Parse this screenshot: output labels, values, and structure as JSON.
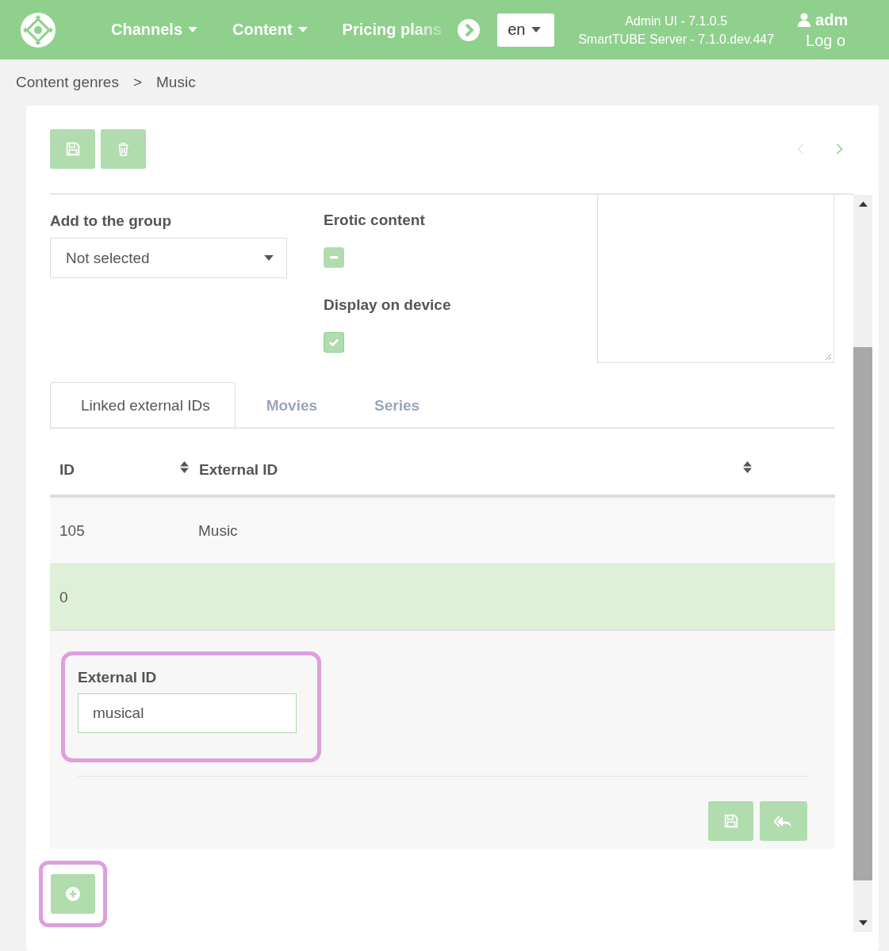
{
  "header": {
    "nav": [
      {
        "label": "Channels",
        "kind": "dropdown"
      },
      {
        "label": "Content",
        "kind": "dropdown"
      },
      {
        "label": "Pricing plans",
        "kind": "overflow"
      }
    ],
    "language": "en",
    "version_lines": [
      "Admin UI - 7.1.0.5",
      "SmartTUBE Server - 7.1.0.dev.447"
    ],
    "user": "adm",
    "logout": "Log o"
  },
  "breadcrumb": {
    "items": [
      "Content genres",
      "Music"
    ],
    "separator": ">"
  },
  "record_nav": {
    "prev_disabled": true,
    "next_disabled": false
  },
  "form": {
    "group": {
      "label": "Add to the group",
      "value": "Not selected"
    },
    "checkboxes": [
      {
        "label": "Erotic content",
        "checked": false,
        "indeterminate": true
      },
      {
        "label": "Display on device",
        "checked": true,
        "indeterminate": false
      }
    ]
  },
  "tabs": [
    {
      "label": "Linked external IDs",
      "selected": true
    },
    {
      "label": "Movies",
      "selected": false
    },
    {
      "label": "Series",
      "selected": false
    }
  ],
  "table": {
    "columns": [
      "ID",
      "External ID"
    ],
    "rows": [
      {
        "cells": [
          "105",
          "Music"
        ],
        "selected": false
      },
      {
        "cells": [
          "0"
        ],
        "selected": true
      }
    ]
  },
  "editor": {
    "label": "External ID",
    "value": "musical",
    "highlighted": true
  },
  "add_button": {
    "highlighted": true
  }
}
